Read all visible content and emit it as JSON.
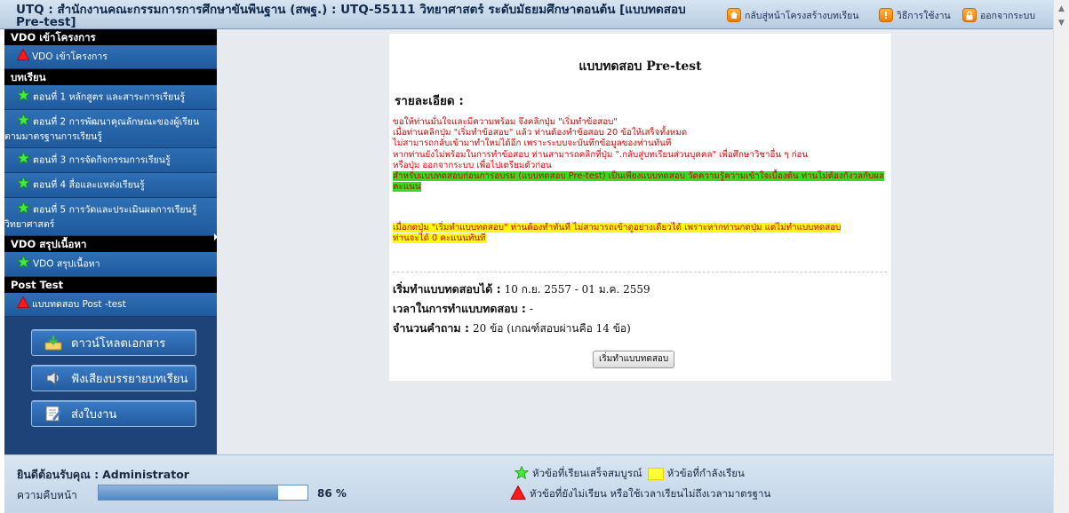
{
  "header": {
    "title": "UTQ : สำนักงานคณะกรรมการการศึกษาขั้นพื้นฐาน (สพฐ.) : UTQ-55111 วิทยาศาสตร์ ระดับมัธยมศึกษาตอนต้น [แบบทดสอบ Pre-test]",
    "links": {
      "back": "กลับสู่หน้าโครงสร้างบทเรียน",
      "help": "วิธีการใช้งาน",
      "logout": "ออกจากระบบ"
    }
  },
  "sidebar": {
    "sections": {
      "vdo_intro": "VDO เข้าโครงการ",
      "lessons": "บทเรียน",
      "vdo_summary": "VDO สรุปเนื้อหา",
      "post_test": "Post Test"
    },
    "items": {
      "vdo_intro": "VDO เข้าโครงการ",
      "lesson1": "ตอนที่ 1 หลักสูตร และสาระการเรียนรู้",
      "lesson2": "ตอนที่ 2 การพัฒนาคุณลักษณะของผู้เรียนตามมาตรฐานการเรียนรู้",
      "lesson3": "ตอนที่ 3 การจัดกิจกรรมการเรียนรู้",
      "lesson4": "ตอนที่ 4 สื่อและแหล่งเรียนรู้",
      "lesson5": "ตอนที่ 5 การวัดและประเมินผลการเรียนรู้วิทยาศาสตร์",
      "vdo_summary": "VDO สรุปเนื้อหา",
      "post_test": "แบบทดสอบ Post -test"
    },
    "buttons": {
      "download": "ดาวน์โหลดเอกสาร",
      "listen": "ฟังเสียงบรรยายบทเรียน",
      "submit": "ส่งใบงาน"
    }
  },
  "main": {
    "title": "แบบทดสอบ Pre-test",
    "detail_heading": "รายละเอียด :",
    "para1": "ขอให้ท่านมั่นใจและมีความพร้อม จึงคลิกปุ่ม \"เริ่มทำข้อสอบ\"\nเมื่อท่านคลิกปุ่ม \"เริ่มทำข้อสอบ\" แล้ว ท่านต้องทำข้อสอบ 20 ข้อให้เสร็จทั้งหมด\nไม่สามารถกลับเข้ามาทำใหม่ได้อีก เพราะระบบจะบันทึกข้อมูลของท่านทันที\nหากท่านยังไม่พร้อมในการทำข้อสอบ ท่านสามารถคลิกที่ปุ่ม \".กลับสู่บทเรียนส่วนบุคคล\" เพื่อศึกษาวิชาอื่น ๆ ก่อน\nหรือปุ่ม ออกจากระบบ เพื่อไปเตรียมตัวก่อน",
    "para_green": "สำหรับแบบทดสอบก่อนการอบรม (แบบทดสอบ Pre-test) เป็นเพียงแบบทดสอบ วัดความรู้ความเข้าใจเบื้องต้น ท่านไม่ต้องกังวลกับผลคะแนน",
    "para_yellow": "เมื่อกดปุ่ม \"เริ่มทำแบบทดสอบ\" ท่านต้องทำทันที ไม่สามารถเข้าดูอย่างเดียวได้ เพราะหากท่านกดปุ่ม แต่ไม่ทำแบบทดสอบ\nท่านจะได้ 0 คะแนนทันที",
    "start_label": "เริ่มทำแบบทดสอบได้ :",
    "start_value": "10 ก.ย. 2557 - 01 ม.ค. 2559",
    "time_label": "เวลาในการทำแบบทดสอบ :",
    "time_value": "-",
    "count_label": "จำนวนคำถาม :",
    "count_value": "20 ข้อ (เกณฑ์สอบผ่านคือ 14 ข้อ)",
    "start_button": "เริ่มทำแบบทดสอบ"
  },
  "footer": {
    "welcome_label": "ยินดีต้อนรับคุณ :",
    "user": "Administrator",
    "progress_label": "ความคืบหน้า",
    "progress": 86,
    "progress_text": "86 %",
    "legend_done": "หัวข้อที่เรียนเสร็จสมบูรณ์",
    "legend_current": "หัวข้อที่กำลังเรียน",
    "legend_notyet": "หัวข้อที่ยังไม่เรียน หรือใช้เวลาเรียนไม่ถึงเวลามาตรฐาน"
  },
  "colors": {
    "sidebar_bg": "#1d4378",
    "item_blue": "#2a68ad",
    "highlight_green": "#33dd22",
    "highlight_yellow": "#ffff00",
    "alert_red": "#e00000"
  },
  "icons": [
    "home-icon",
    "help-icon",
    "lock-icon",
    "warning-triangle-icon",
    "star-icon",
    "download-icon",
    "speaker-icon",
    "document-edit-icon"
  ]
}
